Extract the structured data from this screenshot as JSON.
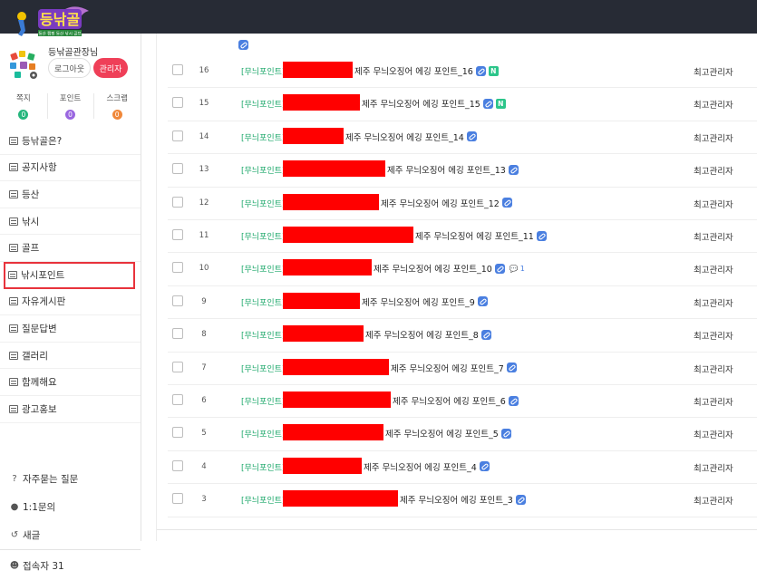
{
  "logo": {
    "text": "등낚골",
    "tagline": "등산 캠핑 등산 낚시 골프"
  },
  "user": {
    "name": "등낚골관장님",
    "logout_label": "로그아웃",
    "admin_label": "관리자"
  },
  "stats": [
    {
      "label": "쪽지",
      "count": "0",
      "color": "#26b67d"
    },
    {
      "label": "포인트",
      "count": "0",
      "color": "#9a67e0"
    },
    {
      "label": "스크랩",
      "count": "0",
      "color": "#f0883a"
    }
  ],
  "menu": [
    {
      "label": "등낚골은?"
    },
    {
      "label": "공지사항"
    },
    {
      "label": "등산"
    },
    {
      "label": "낚시"
    },
    {
      "label": "골프"
    },
    {
      "label": "낚시포인트",
      "active": true
    },
    {
      "label": "자유게시판"
    },
    {
      "label": "질문답변"
    },
    {
      "label": "갤러리"
    },
    {
      "label": "함께해요"
    },
    {
      "label": "광고홍보"
    }
  ],
  "extra_menu": [
    {
      "label": "자주묻는 질문",
      "icon": "question-icon"
    },
    {
      "label": "1:1문의",
      "icon": "chat-icon"
    },
    {
      "label": "새글",
      "icon": "history-icon"
    },
    {
      "label": "접속자 31",
      "icon": "users-icon"
    }
  ],
  "posts": [
    {
      "num": "16",
      "category": "[무늬포인트]",
      "title": "제주 무늬오징어 에깅 포인트_16",
      "author": "최고관리자",
      "link": true,
      "new": true,
      "comments": "",
      "redact_w": 77
    },
    {
      "num": "15",
      "category": "[무늬포인트]",
      "title": "제주 무늬오징어 에깅 포인트_15",
      "author": "최고관리자",
      "link": true,
      "new": true,
      "comments": "",
      "redact_w": 85
    },
    {
      "num": "14",
      "category": "[무늬포인트]",
      "title": "제주 무늬오징어 에깅 포인트_14",
      "author": "최고관리자",
      "link": true,
      "new": false,
      "comments": "",
      "redact_w": 67
    },
    {
      "num": "13",
      "category": "[무늬포인트]",
      "title": "제주 무늬오징어 에깅 포인트_13",
      "author": "최고관리자",
      "link": true,
      "new": false,
      "comments": "",
      "redact_w": 113
    },
    {
      "num": "12",
      "category": "[무늬포인트]",
      "title": "제주 무늬오징어 에깅 포인트_12",
      "author": "최고관리자",
      "link": true,
      "new": false,
      "comments": "",
      "redact_w": 106
    },
    {
      "num": "11",
      "category": "[무늬포인트]",
      "title": "제주 무늬오징어 에깅 포인트_11",
      "author": "최고관리자",
      "link": true,
      "new": false,
      "comments": "",
      "redact_w": 144
    },
    {
      "num": "10",
      "category": "[무늬포인트]",
      "title": "제주 무늬오징어 에깅 포인트_10",
      "author": "최고관리자",
      "link": true,
      "new": false,
      "comments": "1",
      "redact_w": 98
    },
    {
      "num": "9",
      "category": "[무늬포인트]",
      "title": "제주 무늬오징어 에깅 포인트_9",
      "author": "최고관리자",
      "link": true,
      "new": false,
      "comments": "",
      "redact_w": 85
    },
    {
      "num": "8",
      "category": "[무늬포인트]",
      "title": "제주 무늬오징어 에깅 포인트_8",
      "author": "최고관리자",
      "link": true,
      "new": false,
      "comments": "",
      "redact_w": 89
    },
    {
      "num": "7",
      "category": "[무늬포인트]",
      "title": "제주 무늬오징어 에깅 포인트_7",
      "author": "최고관리자",
      "link": true,
      "new": false,
      "comments": "",
      "redact_w": 117
    },
    {
      "num": "6",
      "category": "[무늬포인트]",
      "title": "제주 무늬오징어 에깅 포인트_6",
      "author": "최고관리자",
      "link": true,
      "new": false,
      "comments": "",
      "redact_w": 119
    },
    {
      "num": "5",
      "category": "[무늬포인트]",
      "title": "제주 무늬오징어 에깅 포인트_5",
      "author": "최고관리자",
      "link": true,
      "new": false,
      "comments": "",
      "redact_w": 111
    },
    {
      "num": "4",
      "category": "[무늬포인트]",
      "title": "제주 무늬오징어 에깅 포인트_4",
      "author": "최고관리자",
      "link": true,
      "new": false,
      "comments": "",
      "redact_w": 87
    },
    {
      "num": "3",
      "category": "[무늬포인트]",
      "title": "제주 무늬오징어 에깅 포인트_3",
      "author": "최고관리자",
      "link": true,
      "new": false,
      "comments": "",
      "redact_w": 127
    }
  ]
}
